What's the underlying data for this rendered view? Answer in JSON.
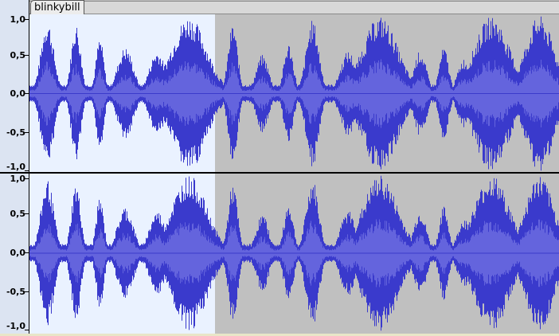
{
  "track": {
    "name": "blinkybill"
  },
  "ruler": {
    "upper": [
      "1,0",
      "0,5",
      "0,0",
      "-0,5",
      "-1,0"
    ],
    "lower": [
      "1,0",
      "0,5",
      "0,0",
      "-0,5",
      "-1,0"
    ]
  },
  "colors": {
    "waveform": "#3a3acc",
    "waveform_rms": "#6464dd",
    "selection_background": "#eaf2ff",
    "unselected_background": "#c0c0c0",
    "ruler_background": "#dce4f2"
  },
  "selection": {
    "end_fraction": 0.35
  }
}
